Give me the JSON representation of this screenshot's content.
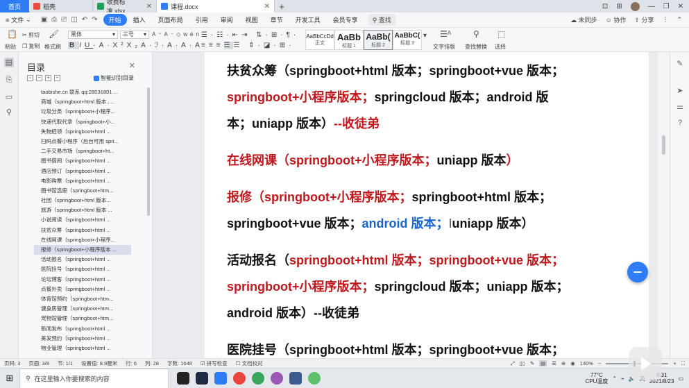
{
  "tabs": {
    "home": "首页",
    "items": [
      {
        "label": "稻壳",
        "color": "#e94b3c"
      },
      {
        "label": "收费标准.xlsx",
        "color": "#1f9d55"
      },
      {
        "label": "课程.docx",
        "color": "#2e7cf6"
      }
    ],
    "add": "+"
  },
  "menubar": {
    "file": "文件",
    "items": [
      "开始",
      "插入",
      "页面布局",
      "引用",
      "审阅",
      "视图",
      "章节",
      "开发工具",
      "会员专享"
    ],
    "active": "开始",
    "search": "查找",
    "right": [
      "未同步",
      "协作",
      "分享"
    ]
  },
  "ribbon": {
    "paste": "粘贴",
    "cut": "剪切",
    "copy": "复制",
    "format_painter": "格式刷",
    "font_name": "黑体",
    "font_size": "三号",
    "styles": [
      {
        "sample": "AaBbCcDd",
        "caption": "正文"
      },
      {
        "sample": "AaBb",
        "caption": "标题 1"
      },
      {
        "sample": "AaBb(",
        "caption": "标题 2"
      },
      {
        "sample": "AaBbC(",
        "caption": "标题 3"
      }
    ],
    "text_layout": "文字排版",
    "find_replace": "查找替换",
    "select": "选择"
  },
  "toc": {
    "title": "目录",
    "smart": "智能识别目录",
    "items": [
      "taobishe.cn 联系 qq:28031801 ...",
      "商城（springboot+html 版本......",
      "垃圾分类（springboot+小程序...",
      "快递代取代拿（springboot+小...",
      "失物招领（springboot+html ...",
      "扫码点餐小程序（后台可用 spri...",
      "二手交易市场（springboot+ht...",
      "图书借阅（springboot+html ...",
      "酒店预订（springboot+html ...",
      "电影购票（springboot+html ...",
      "图书馆选座（springboot+htm...",
      "社团（springboot+html 版本...",
      "旅游（springboot+html 版本 ...",
      "小说阅读（springboot+html ...",
      "扶贫众筹（springboot+html ...",
      "在线网课（springboot+小程序...",
      "报修（springboot+小程序版本 ...",
      "活动报名（springboot+html ...",
      "医院挂号（springboot+html ...",
      "论坛博客（springboot+html ...",
      "点餐外卖（springboot+html ...",
      "体育馆预约（springboot+htm...",
      "健身房管理（springboot+htm...",
      "宠物馆管理（springboot+htm...",
      "新闻发布（springboot+html ...",
      "美发预约（springboot+html ...",
      "物业管理（springboot+html ..."
    ],
    "active_index": 16
  },
  "document": {
    "lines": [
      [
        {
          "t": "扶贫众筹（springboot+html 版本；springboot+vue 版本；",
          "c": "k"
        }
      ],
      [
        {
          "t": "springboot+小程序版本；",
          "c": "r"
        },
        {
          "t": "springcloud 版本；android 版",
          "c": "k"
        }
      ],
      [
        {
          "t": "本；uniapp 版本）",
          "c": "k"
        },
        {
          "t": "--收徒弟",
          "c": "r"
        }
      ],
      [
        {
          "t": "在线网课（springboot+小程序版本；",
          "c": "r"
        },
        {
          "t": "uniapp 版本",
          "c": "k"
        },
        {
          "t": "）",
          "c": "r"
        }
      ],
      [
        {
          "t": "报修（springboot+小程序版本；",
          "c": "r"
        },
        {
          "t": "springboot+html 版本；",
          "c": "k"
        }
      ],
      [
        {
          "t": "springboot+vue 版本；",
          "c": "k"
        },
        {
          "t": "android 版本；",
          "c": "b"
        },
        {
          "t": "I",
          "c": "caret"
        },
        {
          "t": "uniapp 版本）",
          "c": "k"
        }
      ],
      [
        {
          "t": "活动报名（",
          "c": "k"
        },
        {
          "t": "springboot+html 版本；springboot+vue 版本；",
          "c": "r"
        }
      ],
      [
        {
          "t": "springboot+小程序版本；",
          "c": "r"
        },
        {
          "t": "springcloud 版本；uniapp 版本；",
          "c": "k"
        }
      ],
      [
        {
          "t": "android 版本）--收徒弟",
          "c": "k"
        }
      ],
      [
        {
          "t": "医院挂号（springboot+html 版本；springboot+vue 版本；",
          "c": "k"
        }
      ]
    ]
  },
  "statusbar": {
    "page": "页码: 3",
    "pages": "页面: 3/8",
    "section": "节: 1/1",
    "position": "设置值: 8.9厘米",
    "row": "行: 6",
    "col": "列: 28",
    "words": "字数: 1648",
    "spellcheck": "拼写检查",
    "doc_check": "文档校对",
    "zoom": "140%"
  },
  "taskbar": {
    "search_placeholder": "在这里输入你要搜索的内容",
    "temp": "77°C",
    "cpu": "CPU温度",
    "lang": "英",
    "time": "8:31",
    "date": "2021/8/23"
  }
}
